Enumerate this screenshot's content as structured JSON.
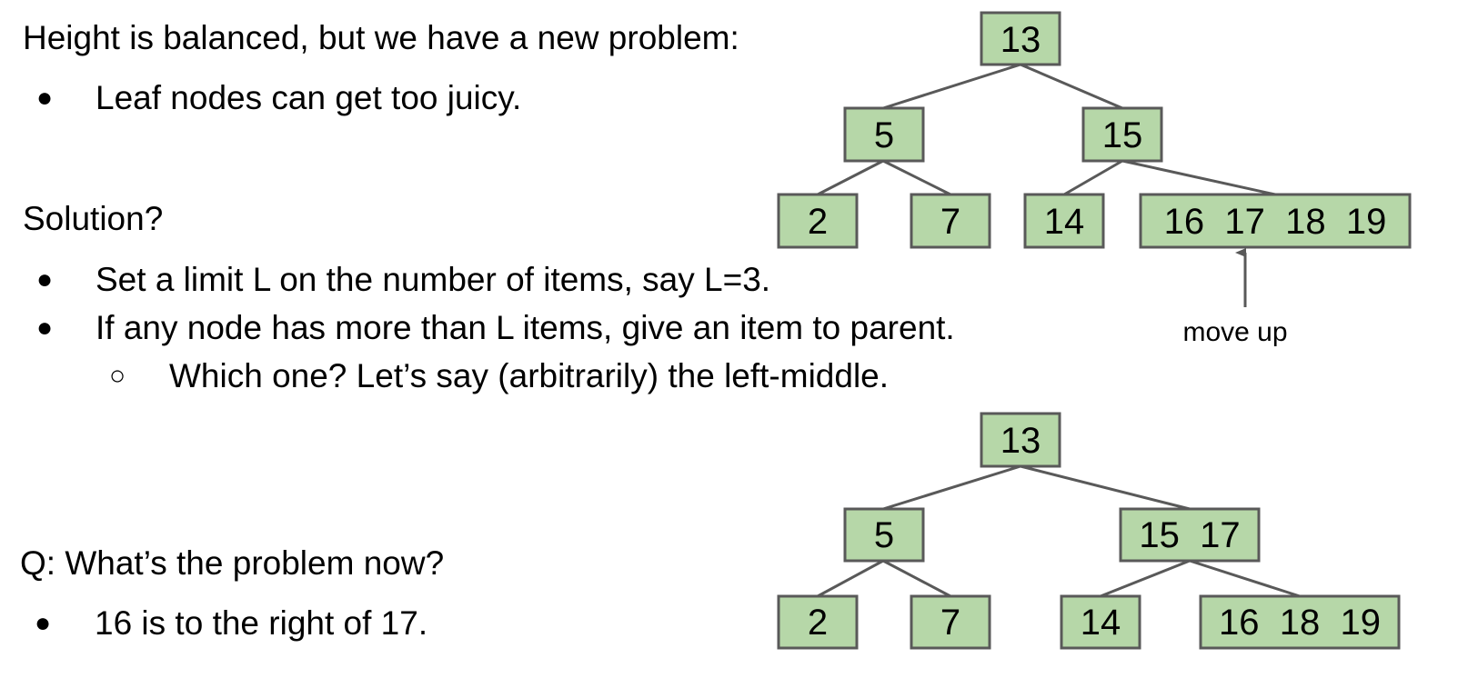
{
  "text": {
    "heading1": "Height is balanced, but we have a new problem:",
    "bullet1": "Leaf nodes can get too juicy.",
    "heading2": "Solution?",
    "bullet2": "Set a limit L on the number of items, say L=3.",
    "bullet3": "If any node has more than L items, give an item to parent.",
    "subbullet1": "Which one? Let’s say (arbitrarily) the left-middle.",
    "heading3": "Q: What’s the problem now?",
    "bullet4": "16 is to the right of 17.",
    "bullet_glyph": "●",
    "subbullet_glyph": "○"
  },
  "tree_top": {
    "root": "13",
    "left": "5",
    "right": "15",
    "leaf1": "2",
    "leaf2": "7",
    "leaf3": "14",
    "leaf4": "16  17  18  19",
    "arrow_label": "move up"
  },
  "tree_bottom": {
    "root": "13",
    "left": "5",
    "right": "15  17",
    "leaf1": "2",
    "leaf2": "7",
    "leaf3": "14",
    "leaf4": "16  18  19"
  },
  "colors": {
    "node_fill": "#b6d7a8",
    "node_stroke": "#595959"
  }
}
